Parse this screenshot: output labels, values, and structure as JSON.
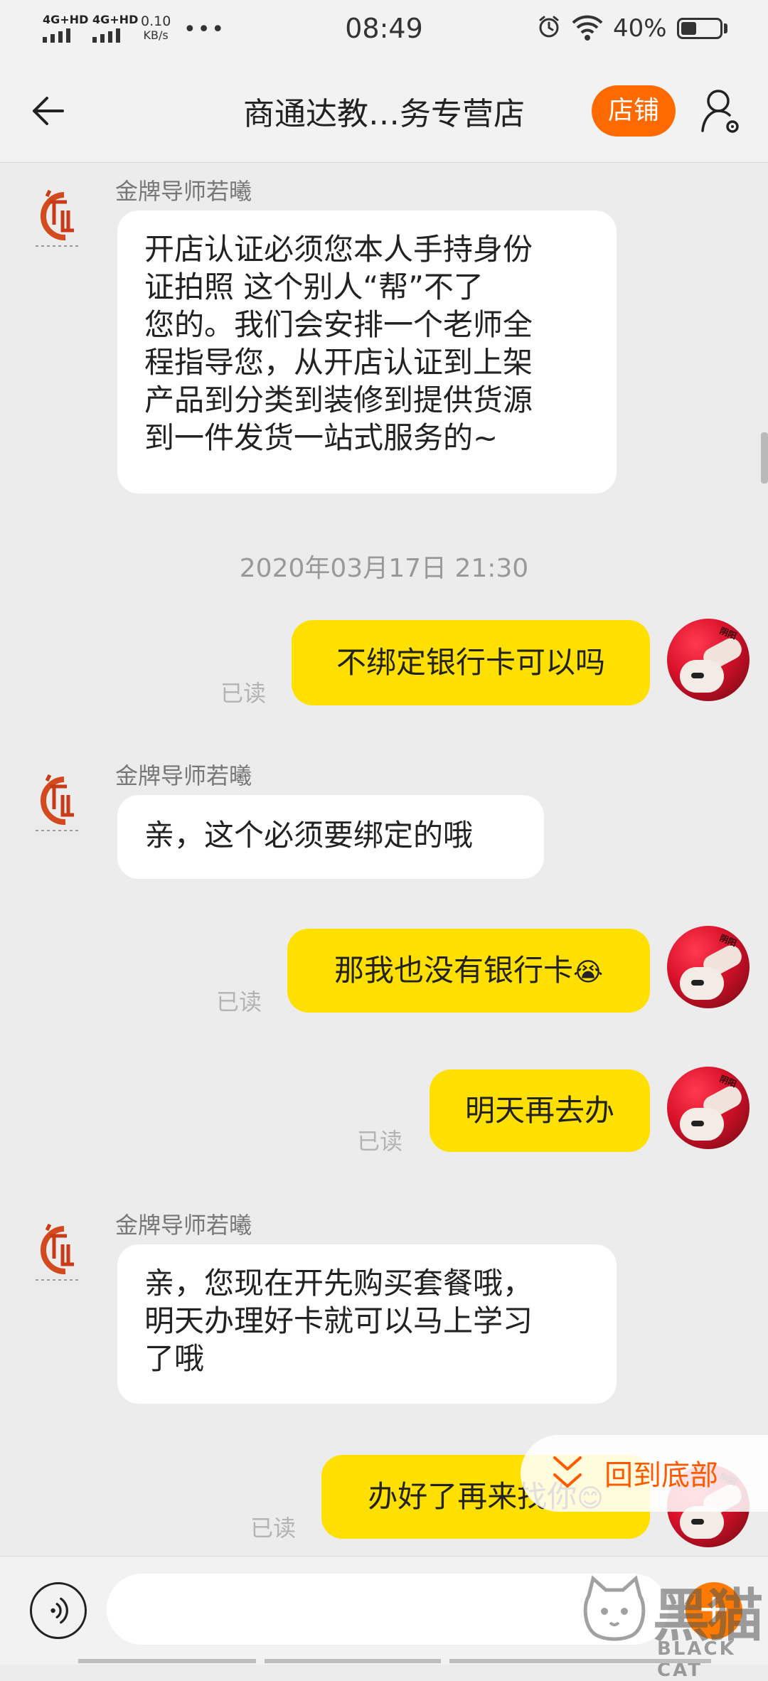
{
  "status_bar": {
    "signal1_label": "4G+HD",
    "signal2_label": "4G+HD",
    "net_speed_value": "0.10",
    "net_speed_unit": "KB/s",
    "more": "•••",
    "time": "08:49",
    "battery_percent": "40%",
    "battery_level": 0.4
  },
  "header": {
    "title": "商通达教…务专营店",
    "shop_button": "店铺",
    "icons": [
      "back-arrow-icon",
      "user-settings-icon"
    ]
  },
  "chat": {
    "shop_sender_name": "金牌导师若曦",
    "read_label": "已读",
    "timestamp": "2020年03月17日 21:30",
    "msg1": [
      "开店认证必须您本人手持身份",
      "证拍照 这个别人“帮”不了",
      "您的。我们会安排一个老师全",
      "程指导您，从开店认证到上架",
      "产品到分类到装修到提供货源",
      "到一件发货一站式服务的~"
    ],
    "msg2": "不绑定银行卡可以吗",
    "msg3": "亲，这个必须要绑定的哦",
    "msg4": "那我也没有银行卡",
    "msg4_emoji": "😭",
    "msg5": "明天再去办",
    "msg6": [
      "亲，您现在开先购买套餐哦，",
      "明天办理好卡就可以马上学习",
      "了哦"
    ],
    "msg7": "办好了再来找你",
    "msg7_emoji": "😊",
    "user_avatar_text": "阴阳"
  },
  "back_to_bottom": "回到底部",
  "input": {
    "placeholder": "",
    "plus": "+"
  },
  "watermark": {
    "cn": "黑猫",
    "en": "BLACK CAT"
  },
  "colors": {
    "accent": "#ff6a00",
    "outgoing_bubble": "#ffe000",
    "incoming_bubble": "#ffffff",
    "background": "#ececec"
  }
}
